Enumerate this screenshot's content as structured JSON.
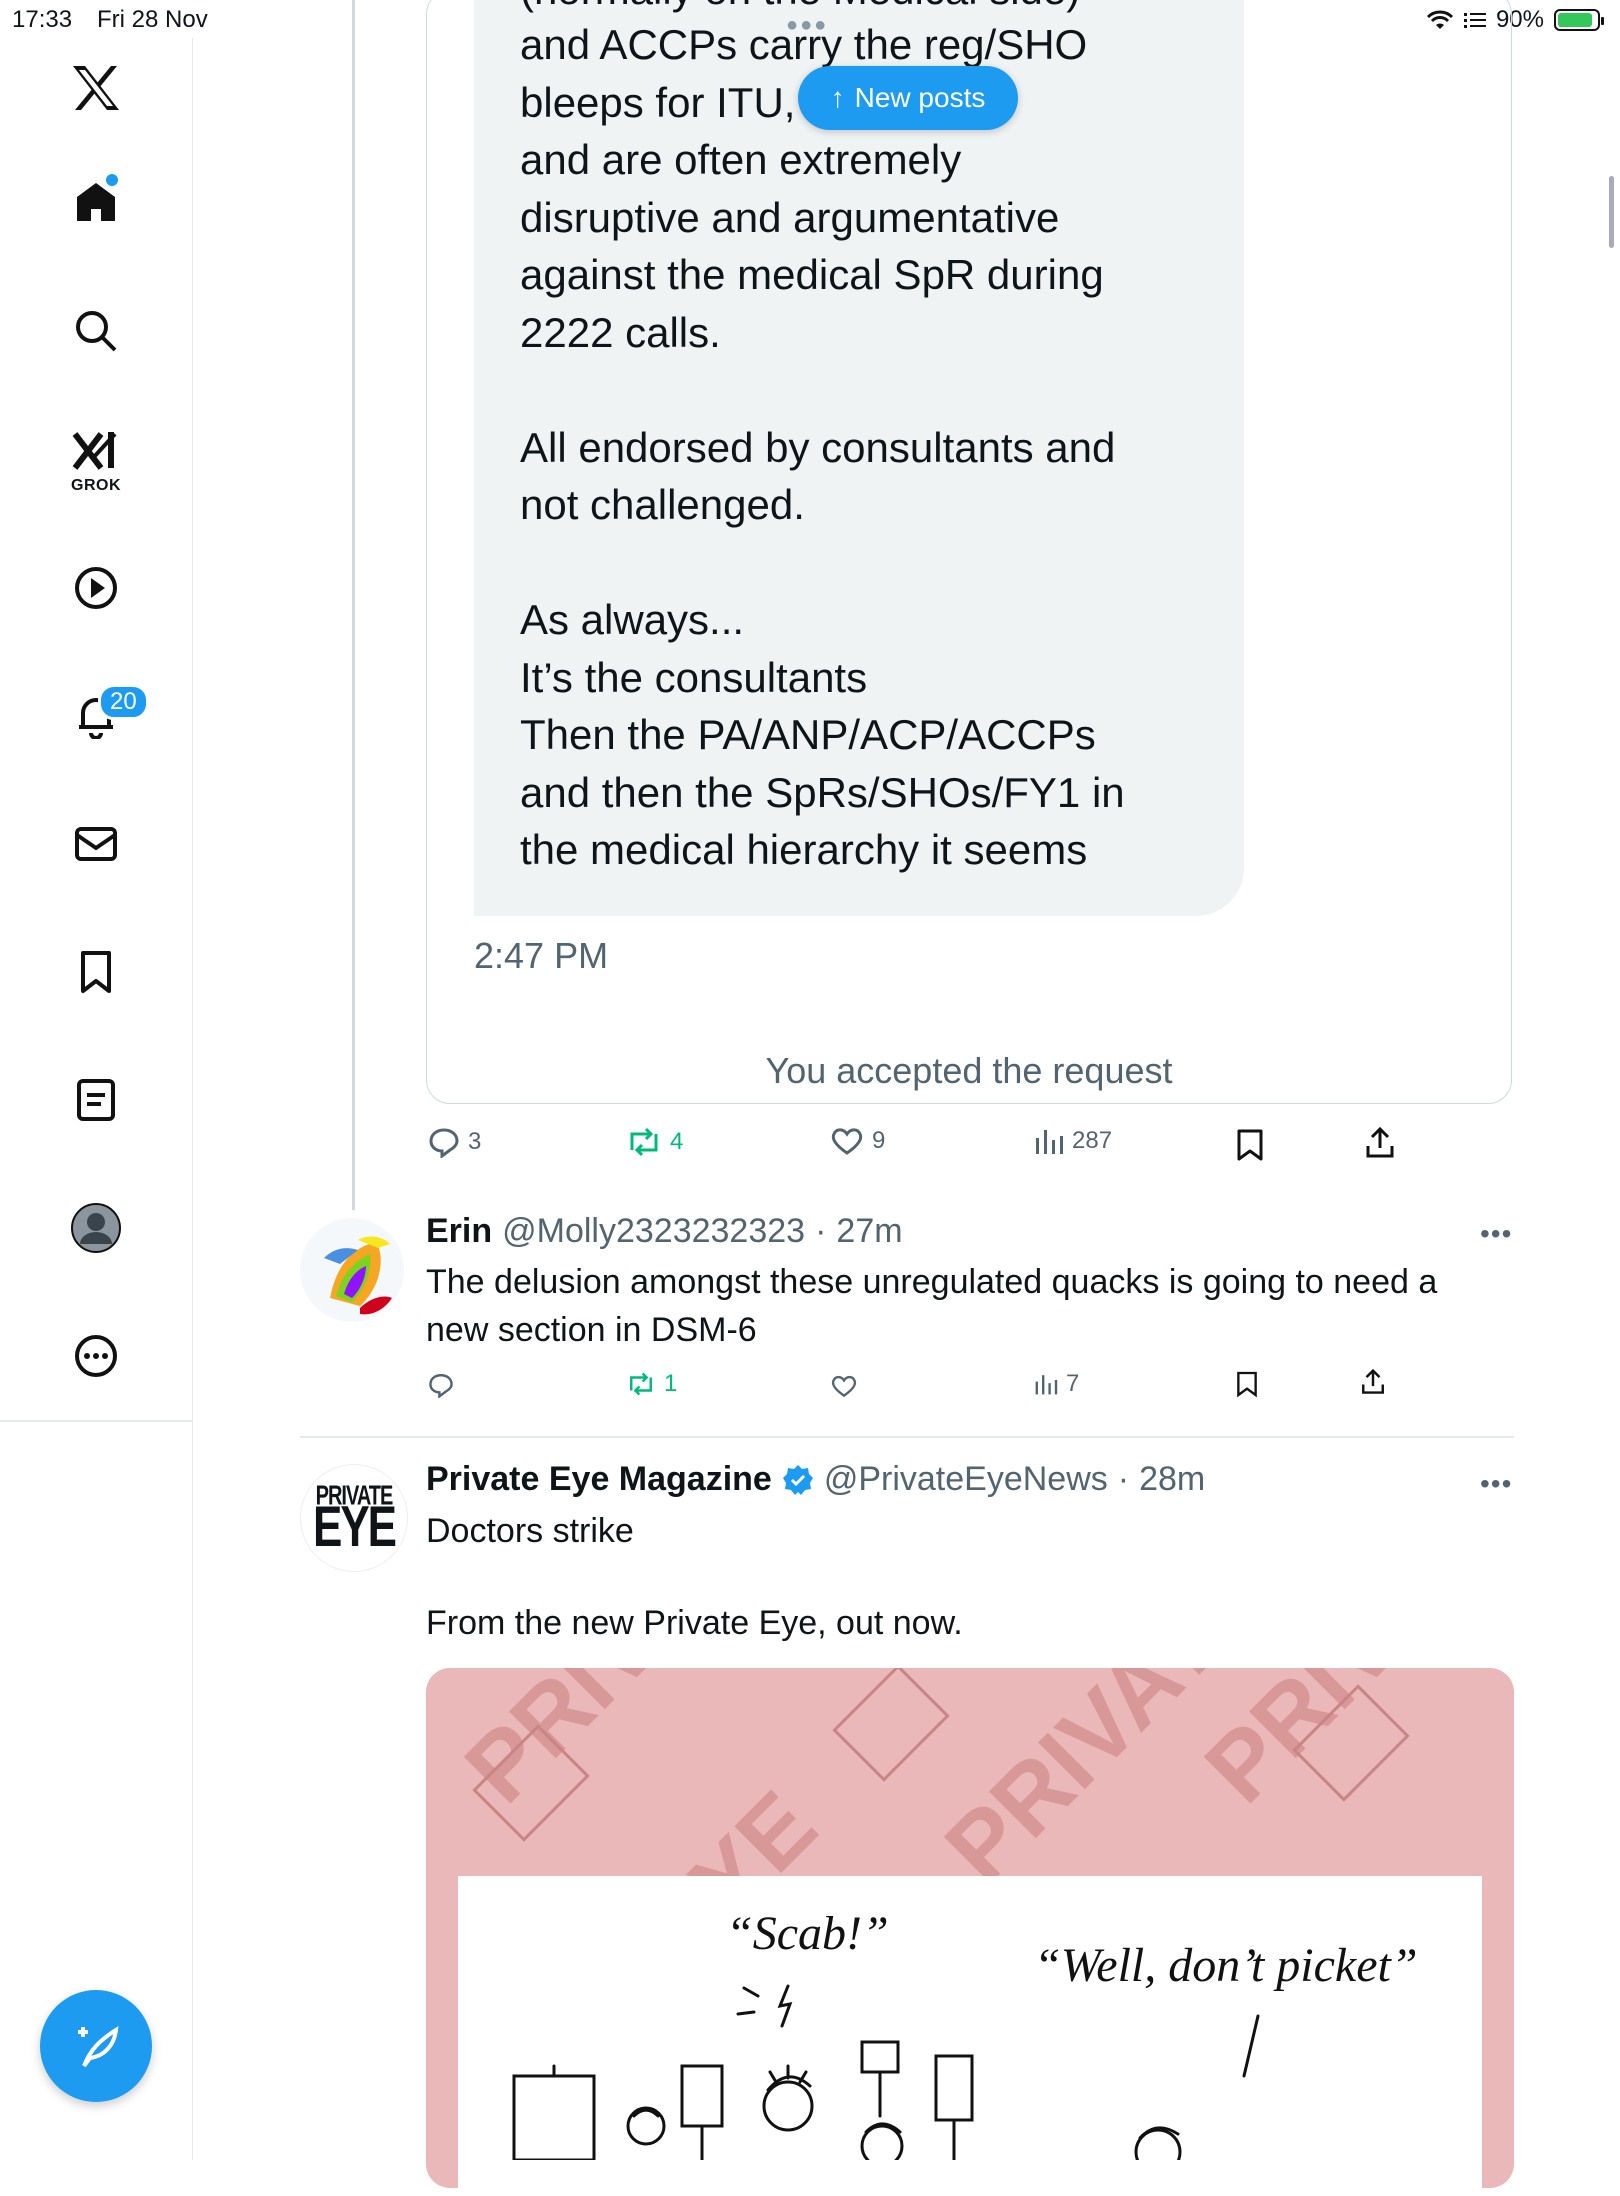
{
  "status_bar": {
    "time": "17:33",
    "date": "Fri 28 Nov",
    "battery": "90%",
    "battery_level": 0.9
  },
  "sidebar": {
    "grok_label": "GROK",
    "notifications_badge": "20"
  },
  "quoted_message": {
    "top_partial": "(normally on the Medical side)",
    "body": "and ACCPs carry the reg/SHO\nbleeps for ITU,           forms\nand are often extremely\ndisruptive and argumentative\nagainst the medical SpR during\n2222 calls.\n\nAll endorsed by consultants and\nnot challenged.\n\nAs always...\nIt’s the consultants\nThen the PA/ANP/ACP/ACCPs\nand then the SpRs/SHOs/FY1 in\nthe medical hierarchy it seems",
    "time": "2:47 PM",
    "accepted": "You accepted the request"
  },
  "new_posts_button": "New posts",
  "main_tweet_actions": {
    "replies": "3",
    "reposts": "4",
    "likes": "9",
    "views": "287"
  },
  "tweets": [
    {
      "name": "Erin",
      "handle": "@Molly2323232323",
      "time": "27m",
      "text": "The delusion amongst these unregulated quacks is going to need a\nnew section  in DSM-6",
      "replies": "",
      "reposts": "1",
      "likes": "",
      "views": "7"
    },
    {
      "name": "Private Eye Magazine",
      "handle": "@PrivateEyeNews",
      "time": "28m",
      "verified": true,
      "avatar_text": [
        "PRIVATE",
        "EYE"
      ],
      "text": "Doctors strike\n\nFrom the new Private Eye, out now.",
      "media": {
        "caption_left": "“Scab!”",
        "caption_right": "“Well, don’t picket”"
      }
    }
  ],
  "colors": {
    "accent": "#1d9bf0",
    "repost": "#00ba7c",
    "muted": "#536471",
    "bubble": "#eff3f4",
    "media_bg": "#eab8b8"
  }
}
